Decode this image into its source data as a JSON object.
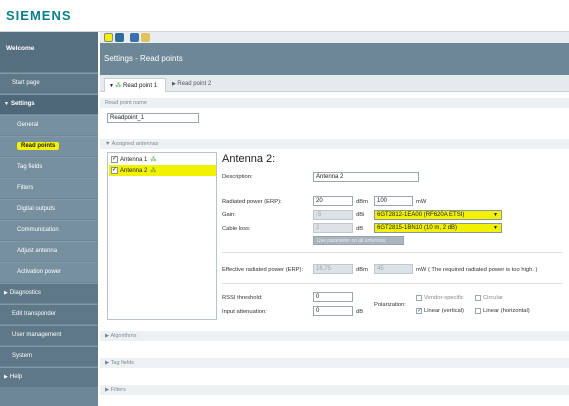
{
  "header": {
    "brand": "SIEMENS"
  },
  "sidebar": {
    "welcome": "Welcome",
    "items": [
      {
        "label": "Start page"
      },
      {
        "label": "Settings"
      },
      {
        "label": "General"
      },
      {
        "label": "Read points"
      },
      {
        "label": "Tag fields"
      },
      {
        "label": "Filters"
      },
      {
        "label": "Digital outputs"
      },
      {
        "label": "Communication"
      },
      {
        "label": "Adjust antenna"
      },
      {
        "label": "Activation power"
      },
      {
        "label": "Diagnostics"
      },
      {
        "label": "Edit transponder"
      },
      {
        "label": "User management"
      },
      {
        "label": "System"
      },
      {
        "label": "Help"
      }
    ]
  },
  "main": {
    "title": "Settings - Read points",
    "tabs": [
      {
        "label": "Read point 1"
      },
      {
        "label": "Read point 2"
      }
    ],
    "read_point_name": {
      "section": "Read point name",
      "value": "Readpoint_1"
    },
    "assigned_antennas": {
      "section": "Assigned antennas",
      "list": [
        {
          "label": "Antenna 1",
          "checked": true
        },
        {
          "label": "Antenna 2",
          "checked": true
        }
      ]
    },
    "antenna": {
      "title": "Antenna 2:",
      "description_label": "Description:",
      "description_value": "Antenna 2",
      "radiated_label": "Radiated power (ERP):",
      "radiated_dbm": "20",
      "radiated_dbm_unit": "dBm",
      "radiated_mw": "100",
      "radiated_mw_unit": "mW",
      "gain_label": "Gain:",
      "gain_value": "-5",
      "gain_unit": "dBi",
      "gain_select": "6GT2812-1EA00 (RF620A ETSI)",
      "cable_label": "Cable loss:",
      "cable_value": "2",
      "cable_unit": "dB",
      "cable_select": "6GT2815-1BN10 (10 m, 2 dB)",
      "use_param_button": "Use parameter on all antennas",
      "eff_label": "Effective radiated power (ERP):",
      "eff_dbm": "16.75",
      "eff_dbm_unit": "dBm",
      "eff_mw": "45",
      "eff_mw_unit": "mW",
      "eff_note": "( The required radiated power is too high. )",
      "rssi_label": "RSSI threshold:",
      "rssi_value": "0",
      "atten_label": "Input attenuation:",
      "atten_value": "0",
      "atten_unit": "dB",
      "polarization_label": "Polarization:",
      "pol_vendor": "Vendor-specific",
      "pol_circular": "Circular",
      "pol_linear_v": "Linear (vertical)",
      "pol_linear_h": "Linear (horizontal)"
    },
    "sections": {
      "algorithms": "Algorithms",
      "tag_fields": "Tag fields",
      "filters": "Filters"
    }
  },
  "colors": {
    "highlight": "#f1f100",
    "sidebar": "#6e8797",
    "brand": "#0b7f8a"
  }
}
